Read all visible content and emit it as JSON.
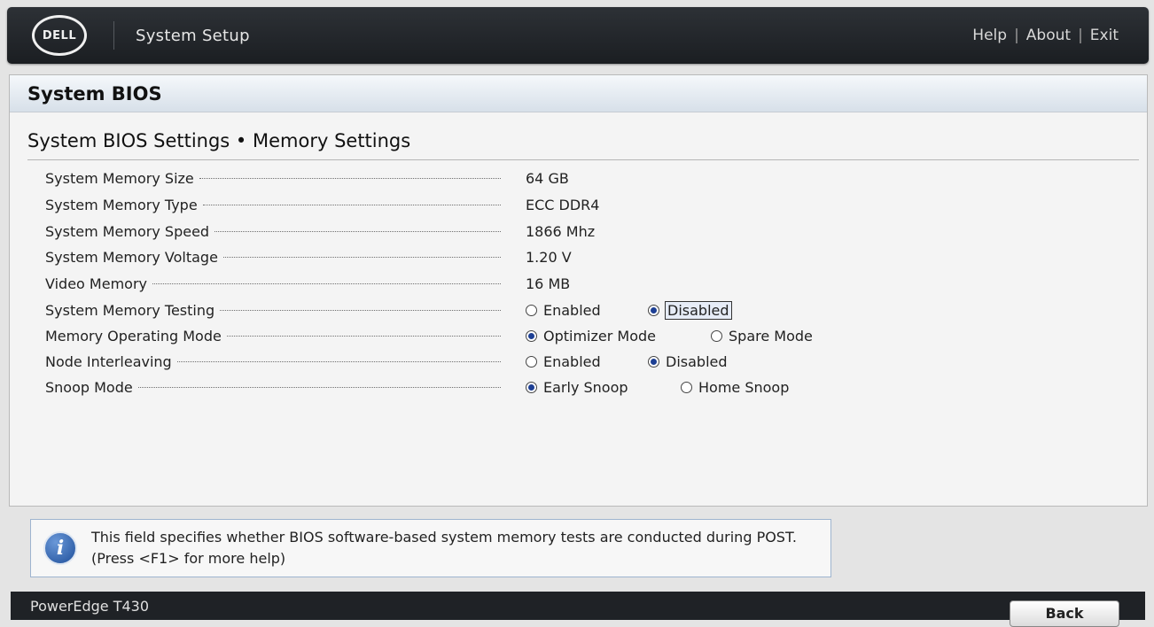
{
  "header": {
    "logo_text": "DELL",
    "app_title": "System Setup",
    "links": {
      "help": "Help",
      "about": "About",
      "exit": "Exit",
      "sep": "|"
    }
  },
  "panel": {
    "title": "System BIOS",
    "section_title": "System BIOS Settings • Memory Settings"
  },
  "settings": {
    "memory_size": {
      "label": "System Memory Size",
      "value": "64 GB"
    },
    "memory_type": {
      "label": "System Memory Type",
      "value": "ECC DDR4"
    },
    "memory_speed": {
      "label": "System Memory Speed",
      "value": "1866 Mhz"
    },
    "memory_voltage": {
      "label": "System Memory Voltage",
      "value": "1.20 V"
    },
    "video_memory": {
      "label": "Video Memory",
      "value": "16 MB"
    },
    "memory_testing": {
      "label": "System Memory Testing",
      "options": [
        "Enabled",
        "Disabled"
      ],
      "selected": "Disabled"
    },
    "operating_mode": {
      "label": "Memory Operating Mode",
      "options": [
        "Optimizer Mode",
        "Spare Mode"
      ],
      "selected": "Optimizer Mode"
    },
    "node_interleaving": {
      "label": "Node Interleaving",
      "options": [
        "Enabled",
        "Disabled"
      ],
      "selected": "Disabled"
    },
    "snoop_mode": {
      "label": "Snoop Mode",
      "options": [
        "Early Snoop",
        "Home Snoop"
      ],
      "selected": "Early Snoop"
    }
  },
  "help": {
    "text": "This field specifies whether BIOS software-based system memory tests are conducted during POST. (Press <F1> for more help)"
  },
  "footer": {
    "model": "PowerEdge T430",
    "back_label": "Back"
  },
  "colors": {
    "header_bg": "#1b1e22",
    "radio_selected": "#1d3f94",
    "help_border": "#9eb4cf"
  }
}
